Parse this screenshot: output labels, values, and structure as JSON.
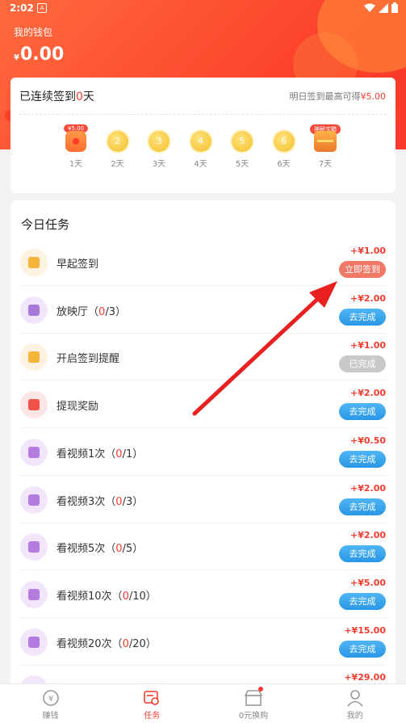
{
  "status_bar": {
    "time": "2:02",
    "notif_icon": "A"
  },
  "wallet": {
    "label": "我的钱包",
    "currency": "¥",
    "amount": "0.00"
  },
  "signin": {
    "title_prefix": "已连续签到",
    "days": "0",
    "title_suffix": "天",
    "hint_prefix": "明日签到最高可得",
    "hint_amount": "¥5.00",
    "days_list": [
      {
        "num": "",
        "label": "1天",
        "bubble": "¥5.00",
        "type": "redbag"
      },
      {
        "num": "2",
        "label": "2天",
        "bubble": "",
        "type": "coin"
      },
      {
        "num": "3",
        "label": "3天",
        "bubble": "",
        "type": "coin"
      },
      {
        "num": "4",
        "label": "4天",
        "bubble": "",
        "type": "coin"
      },
      {
        "num": "5",
        "label": "5天",
        "bubble": "",
        "type": "coin"
      },
      {
        "num": "6",
        "label": "6天",
        "bubble": "",
        "type": "coin"
      },
      {
        "num": "",
        "label": "7天",
        "bubble": "神秘宝箱",
        "type": "chest"
      }
    ]
  },
  "tasks": {
    "title": "今日任务",
    "items": [
      {
        "name": "早起签到",
        "progress_pre": "",
        "progress": "",
        "progress_post": "",
        "reward": "+¥1.00",
        "button": "立即签到",
        "style": "red",
        "icon_color": "#fff2e0",
        "glyph_color": "#f6b43a"
      },
      {
        "name": "放映厅",
        "progress_pre": "（",
        "progress": "0",
        "progress_post": "/3）",
        "reward": "+¥2.00",
        "button": "去完成",
        "style": "blue",
        "icon_color": "#f1e6fb",
        "glyph_color": "#a87ad8"
      },
      {
        "name": "开启签到提醒",
        "progress_pre": "",
        "progress": "",
        "progress_post": "",
        "reward": "+¥1.00",
        "button": "已完成",
        "style": "gray",
        "icon_color": "#fff2e0",
        "glyph_color": "#f6b43a"
      },
      {
        "name": "提现奖励",
        "progress_pre": "",
        "progress": "",
        "progress_post": "",
        "reward": "+¥2.00",
        "button": "去完成",
        "style": "blue",
        "icon_color": "#fde6e6",
        "glyph_color": "#f0524a"
      },
      {
        "name": "看视频1次",
        "progress_pre": "（",
        "progress": "0",
        "progress_post": "/1）",
        "reward": "+¥0.50",
        "button": "去完成",
        "style": "blue",
        "icon_color": "#f1e6fb",
        "glyph_color": "#b57be0"
      },
      {
        "name": "看视频3次",
        "progress_pre": "（",
        "progress": "0",
        "progress_post": "/3）",
        "reward": "+¥2.00",
        "button": "去完成",
        "style": "blue",
        "icon_color": "#f1e6fb",
        "glyph_color": "#b57be0"
      },
      {
        "name": "看视频5次",
        "progress_pre": "（",
        "progress": "0",
        "progress_post": "/5）",
        "reward": "+¥2.00",
        "button": "去完成",
        "style": "blue",
        "icon_color": "#f1e6fb",
        "glyph_color": "#b57be0"
      },
      {
        "name": "看视频10次",
        "progress_pre": "（",
        "progress": "0",
        "progress_post": "/10）",
        "reward": "+¥5.00",
        "button": "去完成",
        "style": "blue",
        "icon_color": "#f1e6fb",
        "glyph_color": "#b57be0"
      },
      {
        "name": "看视频20次",
        "progress_pre": "（",
        "progress": "0",
        "progress_post": "/20）",
        "reward": "+¥15.00",
        "button": "去完成",
        "style": "blue",
        "icon_color": "#f1e6fb",
        "glyph_color": "#b57be0"
      },
      {
        "name": "",
        "progress_pre": "",
        "progress": "",
        "progress_post": "",
        "reward": "+¥29.00",
        "button": "",
        "style": "blue",
        "icon_color": "#f1e6fb",
        "glyph_color": "#b57be0"
      }
    ]
  },
  "tabbar": {
    "items": [
      {
        "label": "赚钱",
        "icon": "coin-icon",
        "active": false
      },
      {
        "label": "任务",
        "icon": "task-icon",
        "active": true
      },
      {
        "label": "0元换购",
        "icon": "shop-icon",
        "active": false,
        "dot": true
      },
      {
        "label": "我的",
        "icon": "user-icon",
        "active": false
      }
    ]
  },
  "colors": {
    "brand": "#fb3f2b",
    "accent_blue": "#2a97e6",
    "reward": "#f43c2f"
  }
}
